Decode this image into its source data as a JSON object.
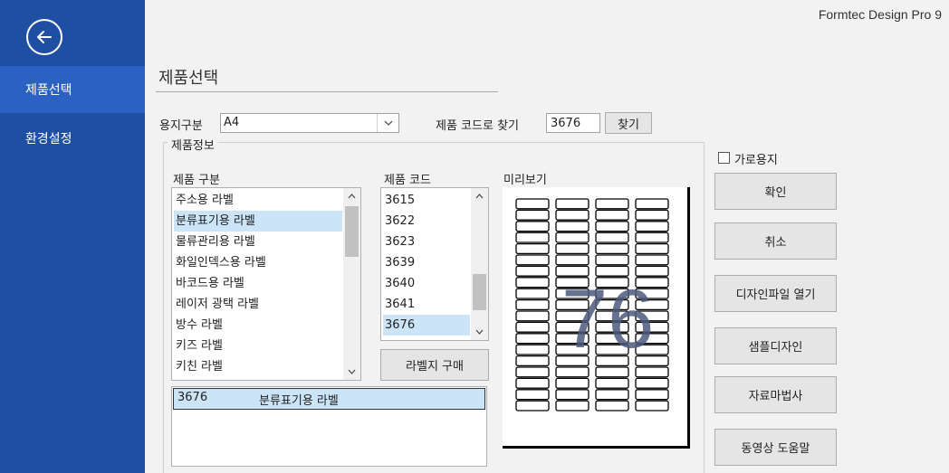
{
  "app": {
    "title": "Formtec Design Pro 9"
  },
  "sidebar": {
    "back_icon": "arrow-left-circle-icon",
    "items": [
      {
        "label": "제품선택",
        "active": true
      },
      {
        "label": "환경설정",
        "active": false
      }
    ]
  },
  "page": {
    "title": "제품선택"
  },
  "paper": {
    "label": "용지구분",
    "value": "A4"
  },
  "search": {
    "label": "제품 코드로 찾기",
    "value": "3676",
    "button": "찾기"
  },
  "product_info": {
    "legend": "제품정보",
    "category_header": "제품 구분",
    "categories": [
      "주소용 라벨",
      "분류표기용 라벨",
      "물류관리용 라벨",
      "화일인덱스용 라벨",
      "바코드용 라벨",
      "레이저 광택 라벨",
      "방수 라벨",
      "키즈 라벨",
      "키친 라벨"
    ],
    "selected_category": "분류표기용 라벨",
    "code_header": "제품 코드",
    "codes": [
      "3615",
      "3622",
      "3623",
      "3639",
      "3640",
      "3641",
      "3676"
    ],
    "selected_code": "3676",
    "buy_button": "라벨지 구매",
    "selection": {
      "code": "3676",
      "name": "분류표기용 라벨"
    }
  },
  "preview": {
    "label": "미리보기",
    "count_label": "76",
    "columns": 4,
    "rows": 19
  },
  "landscape": {
    "label": "가로용지",
    "checked": false
  },
  "actions": [
    "확인",
    "취소",
    "디자인파일 열기",
    "샘플디자인",
    "자료마법사",
    "동영상 도움말"
  ],
  "colors": {
    "sidebar": "#1f4fa3",
    "sidebar_active": "#2c61c4",
    "selection": "#cce4f7"
  }
}
